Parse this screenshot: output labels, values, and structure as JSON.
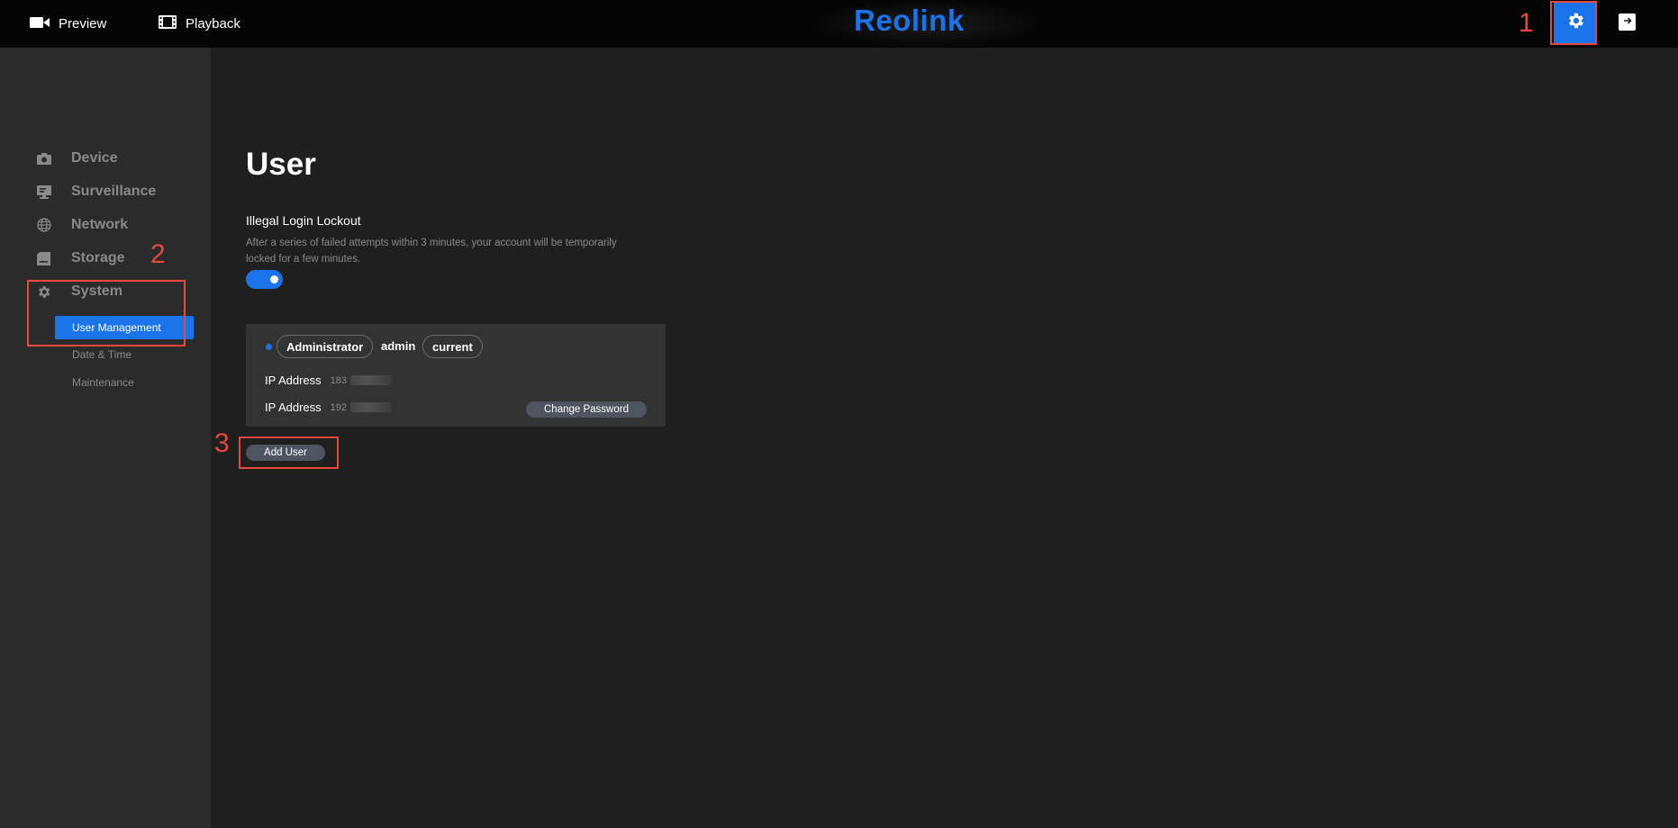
{
  "topbar": {
    "preview_label": "Preview",
    "playback_label": "Playback",
    "logo_text": "Reolink"
  },
  "sidebar": {
    "items": [
      {
        "label": "Device",
        "icon": "camera-icon"
      },
      {
        "label": "Surveillance",
        "icon": "monitor-icon"
      },
      {
        "label": "Network",
        "icon": "globe-icon"
      },
      {
        "label": "Storage",
        "icon": "storage-icon"
      },
      {
        "label": "System",
        "icon": "gear-icon"
      }
    ],
    "sub_items": [
      {
        "label": "User Management",
        "active": true
      },
      {
        "label": "Date & Time",
        "active": false
      },
      {
        "label": "Maintenance",
        "active": false
      }
    ]
  },
  "main": {
    "title": "User",
    "lockout": {
      "label": "Illegal Login Lockout",
      "description": "After a series of failed attempts within 3 minutes, your account will be temporarily locked for a few minutes.",
      "enabled": true
    },
    "user_card": {
      "role": "Administrator",
      "username": "admin",
      "current_tag": "current",
      "ip_rows": [
        {
          "label": "IP Address",
          "value": "183"
        },
        {
          "label": "IP Address",
          "value": "192"
        }
      ],
      "change_password_label": "Change Password"
    },
    "add_user_label": "Add User"
  },
  "annotations": {
    "step1": "1",
    "step2": "2",
    "step3": "3"
  },
  "colors": {
    "accent": "#1a73e8",
    "annotation": "#e8473b",
    "background": "#1f1f1f",
    "sidebar": "#2b2b2b",
    "topbar": "#050505"
  }
}
